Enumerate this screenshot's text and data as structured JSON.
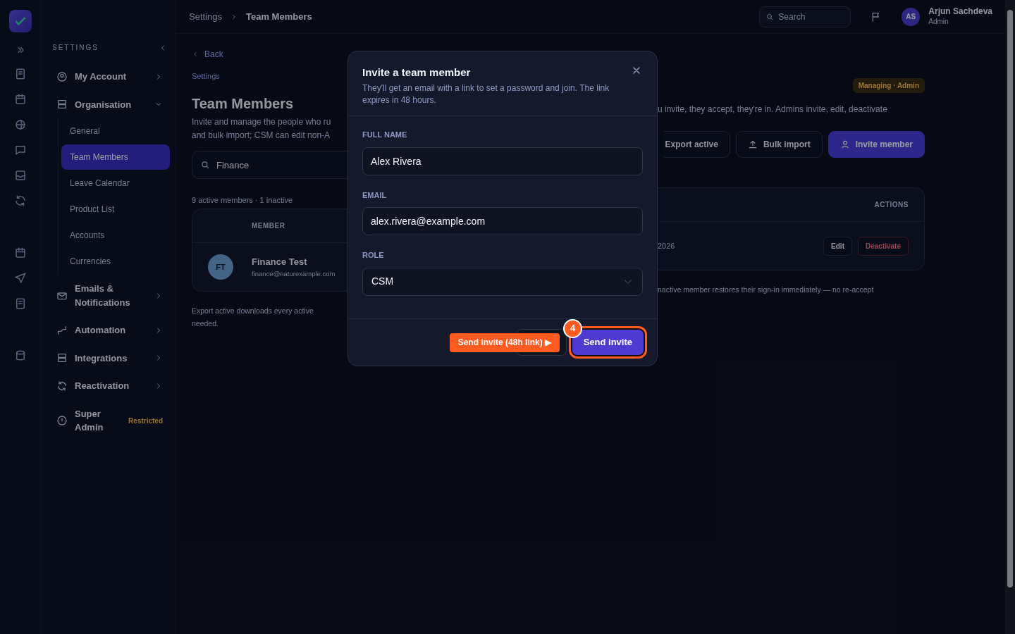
{
  "topbar": {
    "breadcrumb": [
      "Settings",
      "Team Members"
    ],
    "search": {
      "placeholder": "Search"
    },
    "user": {
      "initials": "AS",
      "name": "Arjun Sachdeva",
      "role": "Admin"
    }
  },
  "sidebar": {
    "heading": "SETTINGS",
    "items": [
      {
        "label": "My Account",
        "expanded": false
      },
      {
        "label": "Organisation",
        "expanded": true,
        "children": [
          {
            "label": "General",
            "selected": false
          },
          {
            "label": "Team Members",
            "selected": true
          },
          {
            "label": "Leave Calendar",
            "selected": false
          },
          {
            "label": "Product List",
            "selected": false
          },
          {
            "label": "Accounts",
            "selected": false
          },
          {
            "label": "Currencies",
            "selected": false
          }
        ]
      },
      {
        "label": "Emails & Notifications",
        "expanded": false
      },
      {
        "label": "Automation",
        "expanded": false
      },
      {
        "label": "Integrations",
        "expanded": false
      },
      {
        "label": "Reactivation",
        "expanded": false
      },
      {
        "label": "Super Admin",
        "badge": "Restricted"
      }
    ]
  },
  "page": {
    "back": "Back",
    "crumb": "Settings",
    "title": "Team Members",
    "badge": "Managing · Admin",
    "description_left": [
      "Invite and manage the people who ru",
      "and bulk import; CSM can edit non-A"
    ],
    "description_right": "u invite, they accept, they're in. Admins invite, edit, deactivate",
    "search": {
      "value": "Finance"
    },
    "buttons": [
      "Export active",
      "Bulk import",
      "Invite member"
    ],
    "count": "9 active members · 1 inactive",
    "table": {
      "columns": [
        "MEMBER",
        "ACTIONS"
      ],
      "rows": [
        {
          "initials": "FT",
          "name": "Finance Test",
          "email": "finance@naturexample.com",
          "date_fragment": "2026",
          "actions": [
            "Edit",
            "Deactivate"
          ]
        }
      ]
    },
    "note_left": [
      "Export active downloads every active",
      "needed."
    ],
    "note_right": "nactive member restores their sign-in immediately — no re-accept"
  },
  "modal": {
    "title": "Invite a team member",
    "subtitle": "They'll get an email with a link to set a password and join. The link expires in 48 hours.",
    "fields": [
      {
        "label": "FULL NAME",
        "kind": "text",
        "value": "Alex Rivera"
      },
      {
        "label": "EMAIL",
        "kind": "text",
        "value": "alex.rivera@example.com"
      },
      {
        "label": "ROLE",
        "kind": "select",
        "value": "CSM"
      }
    ],
    "submit": "Send invite"
  },
  "tour": {
    "step": "4",
    "tooltip": "Send invite (48h link) ▶"
  }
}
